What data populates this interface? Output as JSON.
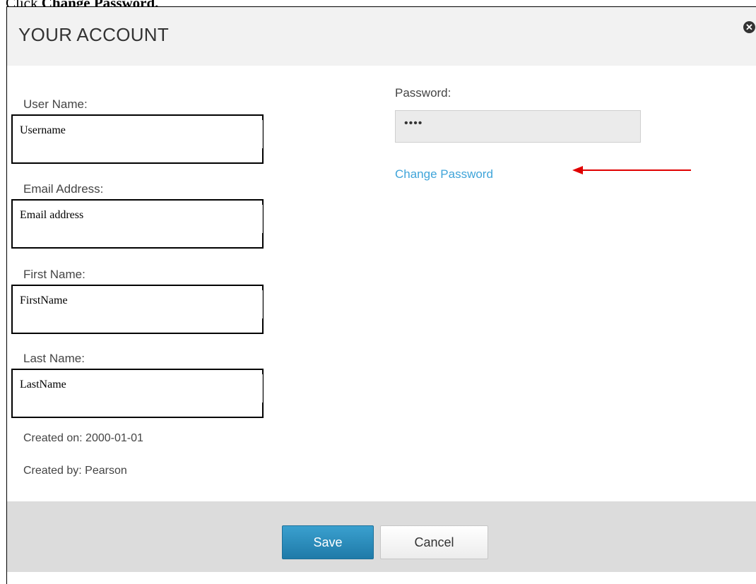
{
  "caption": {
    "prefix": "Click ",
    "emphasis": "Change Password."
  },
  "dialog": {
    "title": "YOUR ACCOUNT",
    "close_icon": "close-icon"
  },
  "fields": {
    "username": {
      "label": "User Name:",
      "value": "Username"
    },
    "email": {
      "label": "Email Address:",
      "value": "Email address"
    },
    "first_name": {
      "label": "First Name:",
      "value": "FirstName"
    },
    "last_name": {
      "label": "Last Name:",
      "value": "LastName"
    }
  },
  "meta": {
    "created_on": "Created on: 2000-01-01",
    "created_by": "Created by: Pearson"
  },
  "password": {
    "label": "Password:",
    "value": "••••",
    "change_link": "Change Password"
  },
  "annotation": {
    "arrow_color": "#e00000"
  },
  "footer": {
    "save_label": "Save",
    "cancel_label": "Cancel"
  },
  "colors": {
    "link": "#3fa4d9",
    "primary_button": "#2b8ab8",
    "header_bg": "#f2f2f2",
    "footer_bg": "#dcdcdc"
  }
}
